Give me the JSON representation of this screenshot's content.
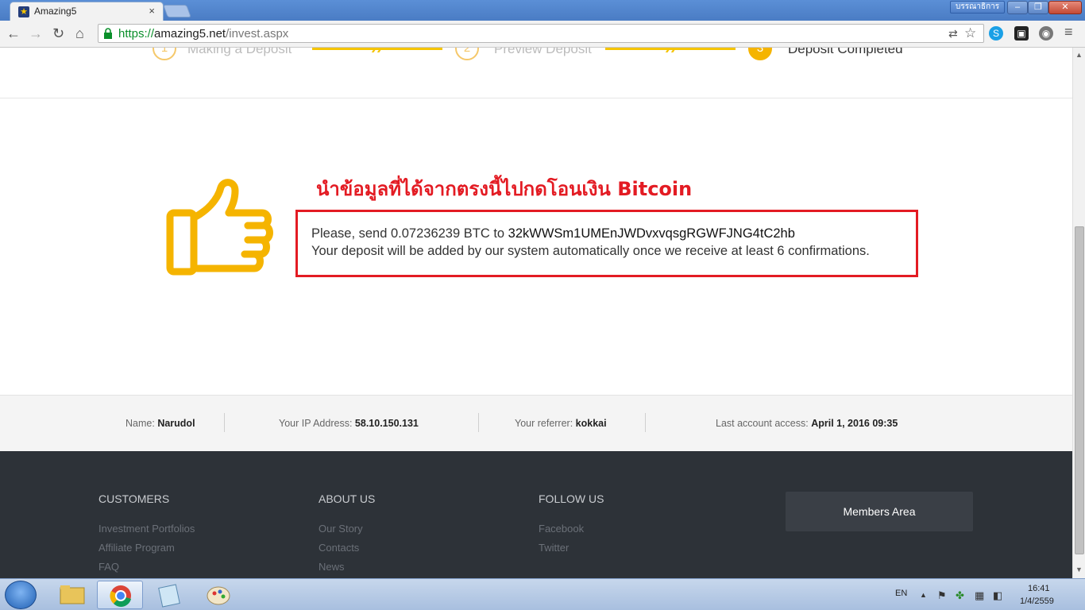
{
  "browser": {
    "tab_title": "Amazing5",
    "tab_close": "×",
    "user_label": "บรรณาธิการ",
    "url_scheme": "https://",
    "url_host": "amazing5.net",
    "url_path": "/invest.aspx",
    "minimize": "–",
    "restore": "❐",
    "close": "✕"
  },
  "steps": [
    {
      "number": "1",
      "label": "Making a Deposit"
    },
    {
      "number": "2",
      "label": "Preview Deposit"
    },
    {
      "number": "3",
      "label": "Deposit Completed"
    }
  ],
  "annotation": "นำข้อมูลที่ได้จากตรงนี้ไปกดโอนเงิน   Bitcoin",
  "deposit": {
    "prefix": "Please, send 0.07236239 BTC to ",
    "address": "32kWWSm1UMEnJWDvxvqsgRGWFJNG4tC2hb",
    "notice": "Your deposit will be added by our system automatically once we receive at least 6 confirmations."
  },
  "account": {
    "name_label": "Name:",
    "name_value": "Narudol",
    "ip_label": "Your IP Address:",
    "ip_value": "58.10.150.131",
    "referrer_label": "Your referrer:",
    "referrer_value": "kokkai",
    "access_label": "Last account access:",
    "access_value": "April 1, 2016 09:35"
  },
  "footer": {
    "customers": {
      "heading": "CUSTOMERS",
      "links": [
        "Investment Portfolios",
        "Affiliate Program",
        "FAQ"
      ]
    },
    "about": {
      "heading": "ABOUT US",
      "links": [
        "Our Story",
        "Contacts",
        "News"
      ]
    },
    "follow": {
      "heading": "FOLLOW US",
      "links": [
        "Facebook",
        "Twitter"
      ]
    },
    "members_button": "Members Area"
  },
  "taskbar": {
    "language": "EN",
    "time": "16:41",
    "date": "1/4/2559"
  },
  "colors": {
    "accent_yellow": "#f5b400",
    "annotation_red": "#e31b23",
    "footer_bg": "#2d3238"
  }
}
